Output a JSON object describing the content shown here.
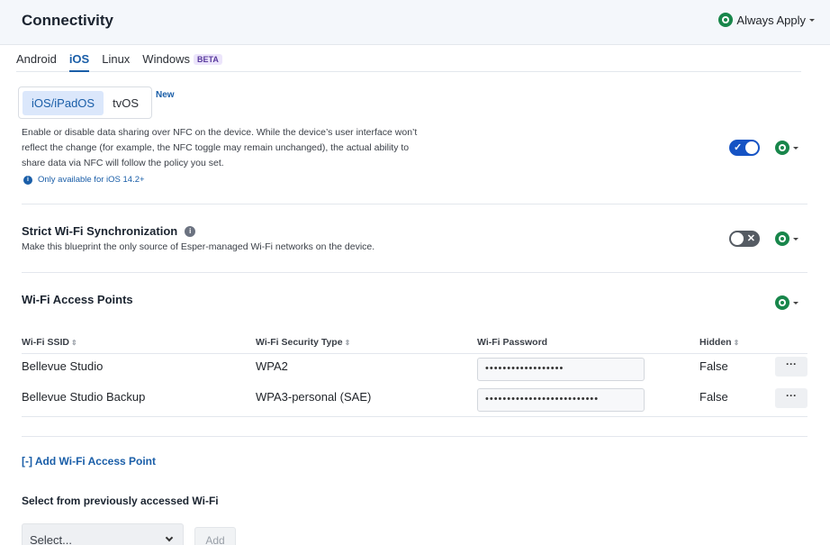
{
  "header": {
    "title": "Connectivity",
    "apply_label": "Always Apply"
  },
  "os_tabs": [
    {
      "label": "Android"
    },
    {
      "label": "iOS"
    },
    {
      "label": "Linux"
    },
    {
      "label": "Windows"
    }
  ],
  "beta_badge": "BETA",
  "platform_toggle": {
    "options": [
      "iOS/iPadOS",
      "tvOS"
    ],
    "selected": "iOS/iPadOS",
    "new_badge": "New"
  },
  "nfc": {
    "description": "Enable or disable data sharing over NFC on the device. While the device’s user interface won’t reflect the change (for example, the NFC toggle may remain unchanged), the actual ability to share data via NFC will follow the policy you set.",
    "note": "Only available for iOS 14.2+",
    "enabled": true
  },
  "strict_wifi": {
    "title": "Strict Wi-Fi Synchronization",
    "description": "Make this blueprint the only source of Esper-managed Wi-Fi networks on the device.",
    "enabled": false
  },
  "access_points": {
    "title": "Wi-Fi Access Points",
    "columns": [
      "Wi-Fi SSID",
      "Wi-Fi Security Type",
      "Wi-Fi Password",
      "Hidden"
    ],
    "rows": [
      {
        "ssid": "Bellevue Studio",
        "security": "WPA2",
        "password": "••••••••••••••••••",
        "hidden": "False"
      },
      {
        "ssid": "Bellevue Studio Backup",
        "security": "WPA3-personal (SAE)",
        "password": "••••••••••••••••••••••••••",
        "hidden": "False"
      }
    ],
    "more_label": "···"
  },
  "add_link": "[-] Add Wi-Fi Access Point",
  "previous_wifi": {
    "label": "Select from previously accessed Wi-Fi",
    "placeholder": "Select...",
    "add_label": "Add"
  },
  "colors": {
    "accent": "#1a5ea8",
    "toggle_on": "#1553c4",
    "toggle_off": "#555b63",
    "policy_green": "#18864b"
  }
}
